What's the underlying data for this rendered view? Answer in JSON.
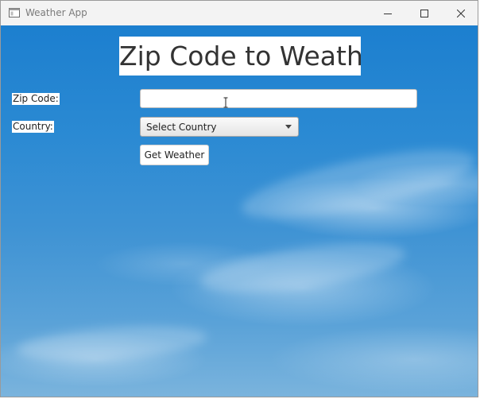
{
  "window": {
    "title": "Weather App"
  },
  "main": {
    "heading": "Zip Code to Weather",
    "zip_label": "Zip Code:",
    "zip_value": "",
    "zip_placeholder": "",
    "country_label": "Country:",
    "country_selected": "Select Country",
    "get_weather_label": "Get Weather"
  },
  "icons": {
    "app": "app-window-icon",
    "minimize": "minimize-icon",
    "maximize": "maximize-icon",
    "close": "close-icon",
    "dropdown": "chevron-down-icon",
    "cursor": "text-cursor-icon"
  },
  "colors": {
    "sky_top": "#1c7fcf",
    "sky_bottom": "#7bb4dd",
    "title_text": "#7a7a7a"
  }
}
